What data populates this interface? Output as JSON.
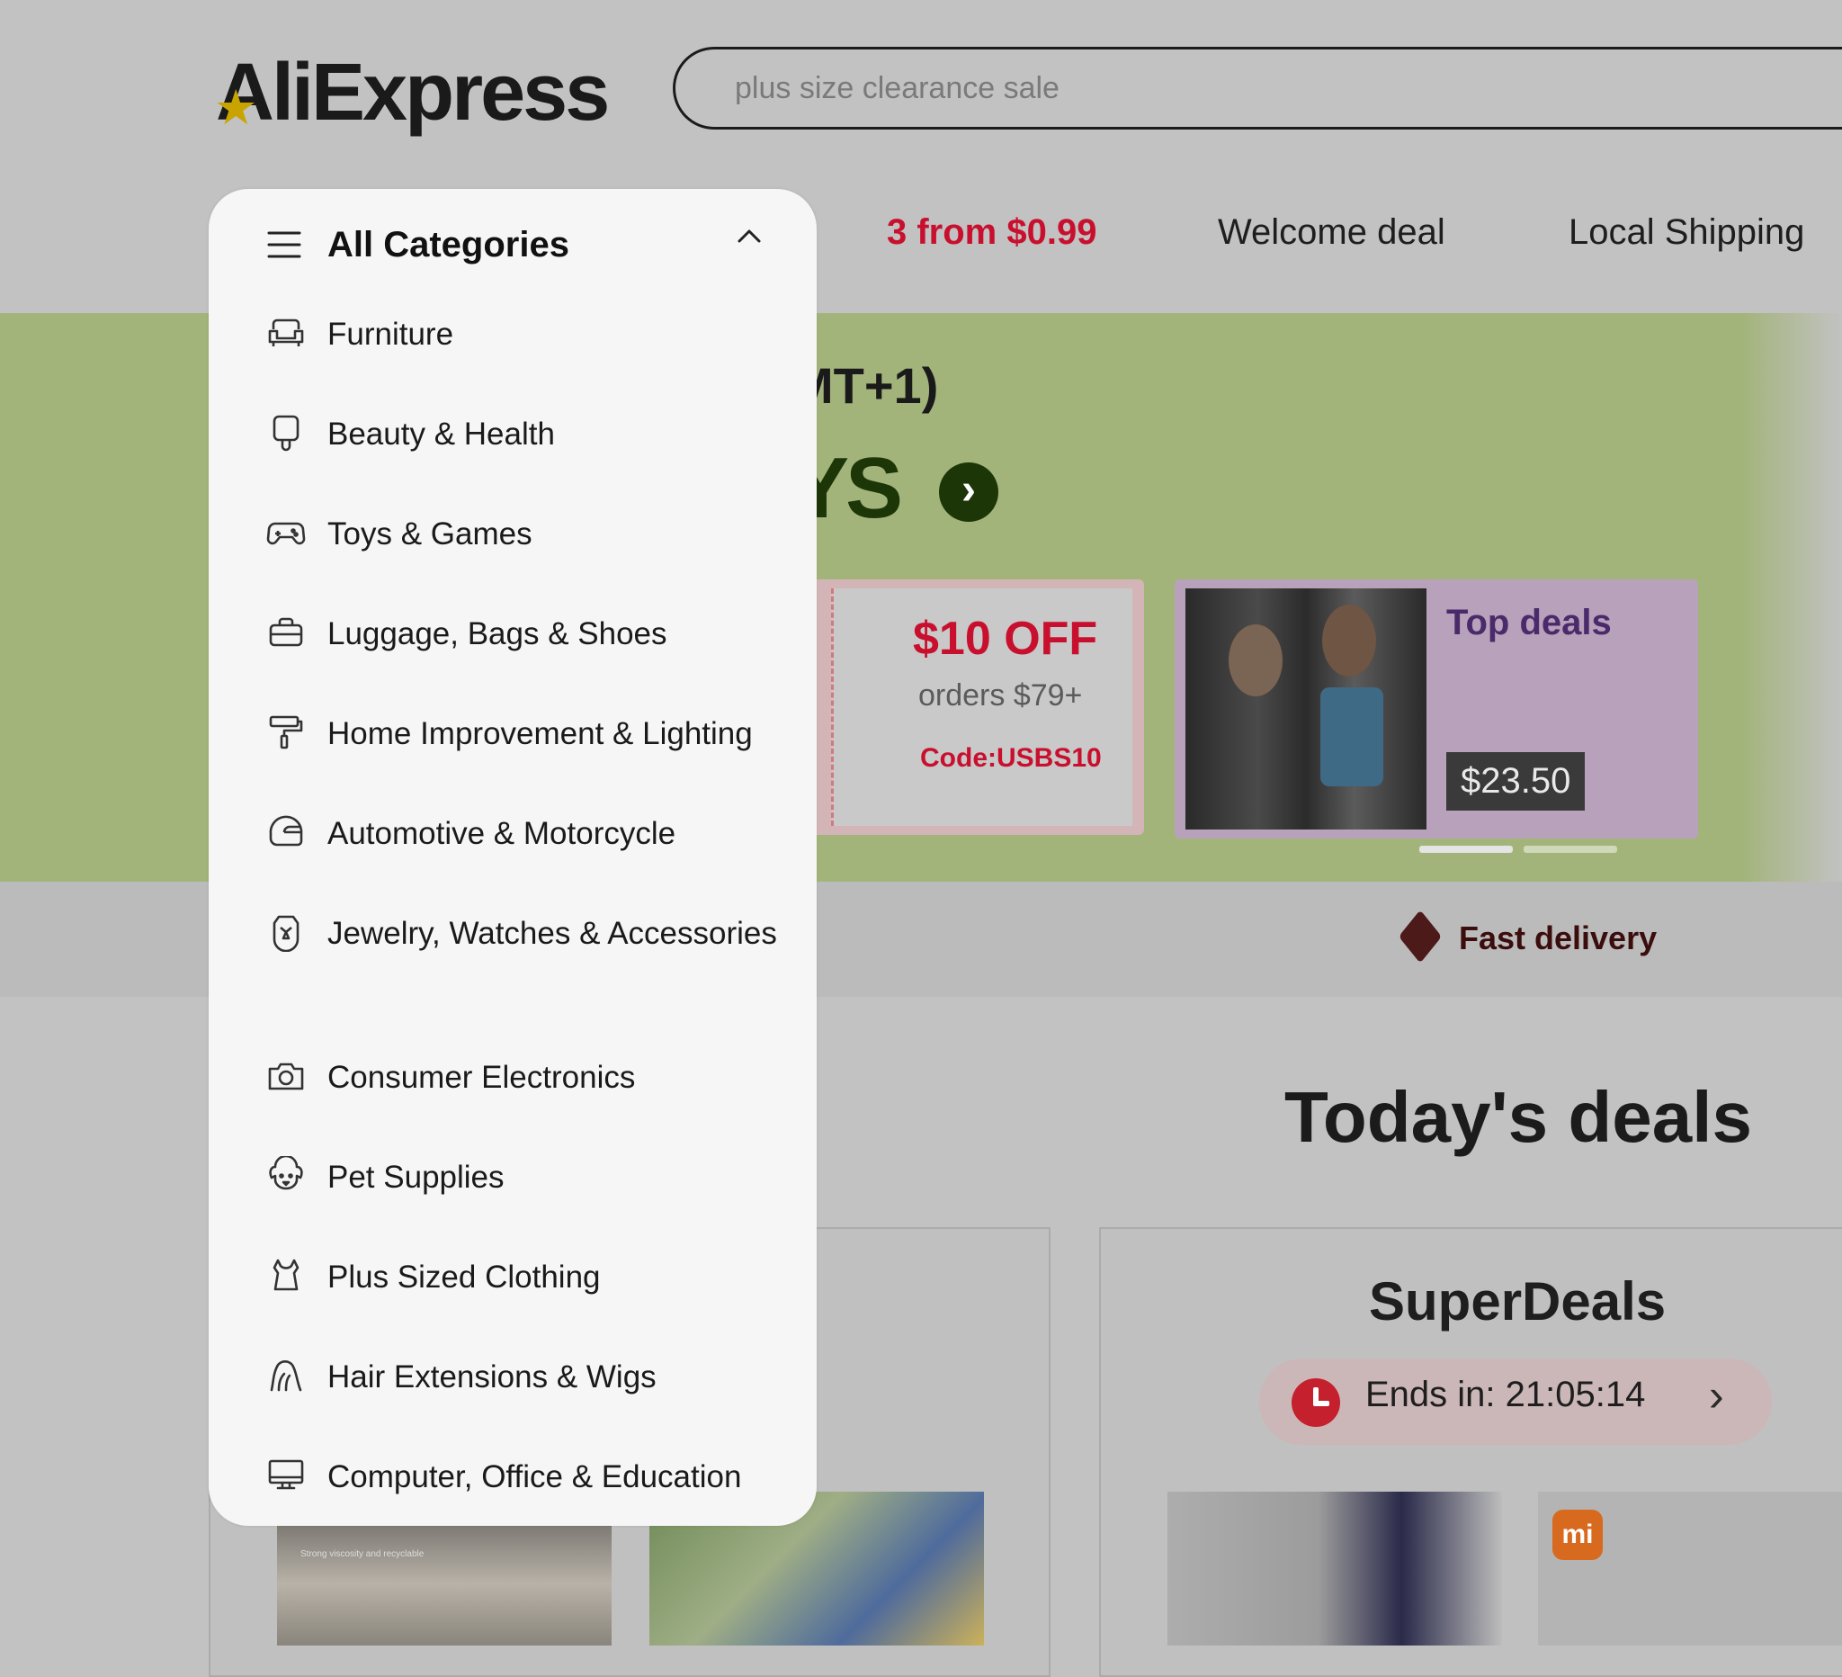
{
  "header": {
    "logo_text": "AliExpress",
    "search_placeholder": "plus size clearance sale"
  },
  "nav": {
    "items": [
      "3 from $0.99",
      "Welcome deal",
      "Local Shipping"
    ]
  },
  "banner": {
    "partial_title": "MT+1)",
    "partial_headline": "YS",
    "coupon": {
      "title": "$10 OFF",
      "subtitle": "orders $79+",
      "code": "Code:USBS10"
    },
    "top_deals": {
      "title": "Top deals",
      "price": "$23.50"
    }
  },
  "strip": {
    "fast_delivery": "Fast delivery"
  },
  "todays_deals": {
    "heading": "Today's deals",
    "superdeals_title": "SuperDeals",
    "timer_text": "Ends in: 21:05:14",
    "thumb_caption": "Strong viscosity and recyclable",
    "brand_badge": "mi"
  },
  "dropdown": {
    "title": "All Categories",
    "categories": [
      {
        "label": "Furniture",
        "icon": "sofa-icon"
      },
      {
        "label": "Beauty & Health",
        "icon": "mirror-icon"
      },
      {
        "label": "Toys & Games",
        "icon": "gamepad-icon"
      },
      {
        "label": "Luggage, Bags & Shoes",
        "icon": "bag-icon"
      },
      {
        "label": "Home Improvement & Lighting",
        "icon": "paint-roller-icon"
      },
      {
        "label": "Automotive & Motorcycle",
        "icon": "helmet-icon"
      },
      {
        "label": "Jewelry, Watches & Accessories",
        "icon": "diamond-icon"
      },
      {
        "label": "Consumer Electronics",
        "icon": "camera-icon"
      },
      {
        "label": "Pet Supplies",
        "icon": "dog-icon"
      },
      {
        "label": "Plus Sized Clothing",
        "icon": "dress-icon"
      },
      {
        "label": "Hair Extensions & Wigs",
        "icon": "hair-icon"
      },
      {
        "label": "Computer, Office & Education",
        "icon": "monitor-icon"
      }
    ]
  }
}
